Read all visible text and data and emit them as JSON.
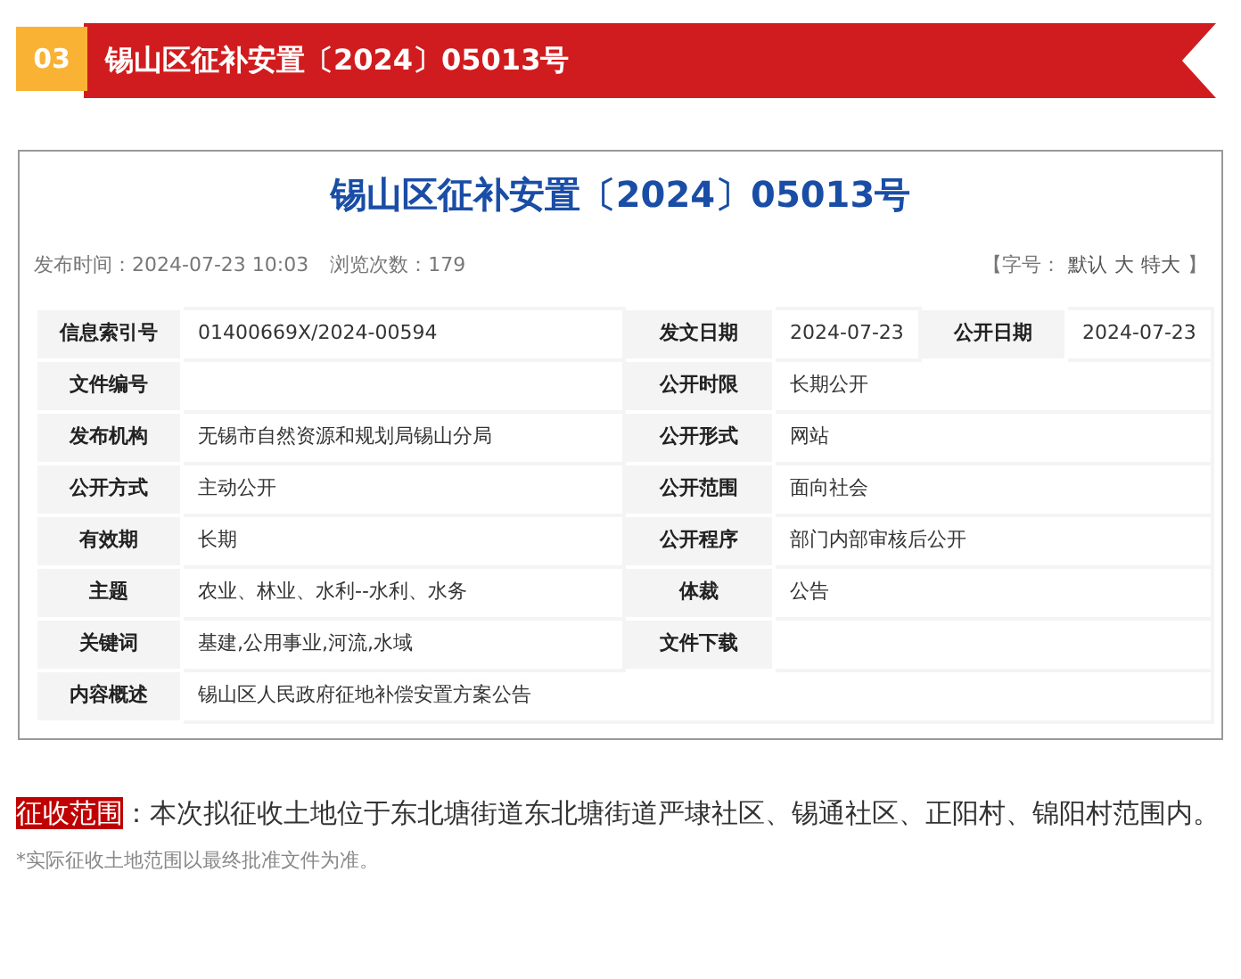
{
  "banner": {
    "number": "03",
    "title": "锡山区征补安置〔2024〕05013号"
  },
  "document": {
    "title": "锡山区征补安置〔2024〕05013号",
    "publish_label": "发布时间：",
    "publish_time": "2024-07-23 10:03",
    "views_label": "浏览次数：",
    "views": "179",
    "font_size": {
      "open": "【字号：",
      "options": [
        "默认",
        "大",
        "特大"
      ],
      "close": "】"
    },
    "rows": [
      [
        {
          "label": "信息索引号",
          "value": "01400669X/2024-00594"
        },
        {
          "label": "发文日期",
          "value": "2024-07-23"
        },
        {
          "label": "公开日期",
          "value": "2024-07-23"
        }
      ],
      [
        {
          "label": "文件编号"
        },
        {
          "label": "公开时限",
          "value": "长期公开"
        }
      ],
      [
        {
          "label": "发布机构",
          "value": "无锡市自然资源和规划局锡山分局"
        },
        {
          "label": "公开形式",
          "value": "网站"
        }
      ],
      [
        {
          "label": "公开方式",
          "value": "主动公开"
        },
        {
          "label": "公开范围",
          "value": "面向社会"
        }
      ],
      [
        {
          "label": "有效期",
          "value": "长期"
        },
        {
          "label": "公开程序",
          "value": "部门内部审核后公开"
        }
      ],
      [
        {
          "label": "主题",
          "value": "农业、林业、水利--水利、水务"
        },
        {
          "label": "体裁",
          "value": "公告"
        }
      ],
      [
        {
          "label": "关键词",
          "value": "基建,公用事业,河流,水域"
        },
        {
          "label": "文件下载"
        }
      ],
      [
        {
          "label": "内容概述",
          "value": "锡山区人民政府征地补偿安置方案公告"
        }
      ]
    ]
  },
  "scope": {
    "label": "征收范围",
    "text": "：本次拟征收土地位于东北塘街道东北塘街道严埭社区、锡通社区、正阳村、锦阳村范围内。"
  },
  "note": "*实际征收土地范围以最终批准文件为准。"
}
